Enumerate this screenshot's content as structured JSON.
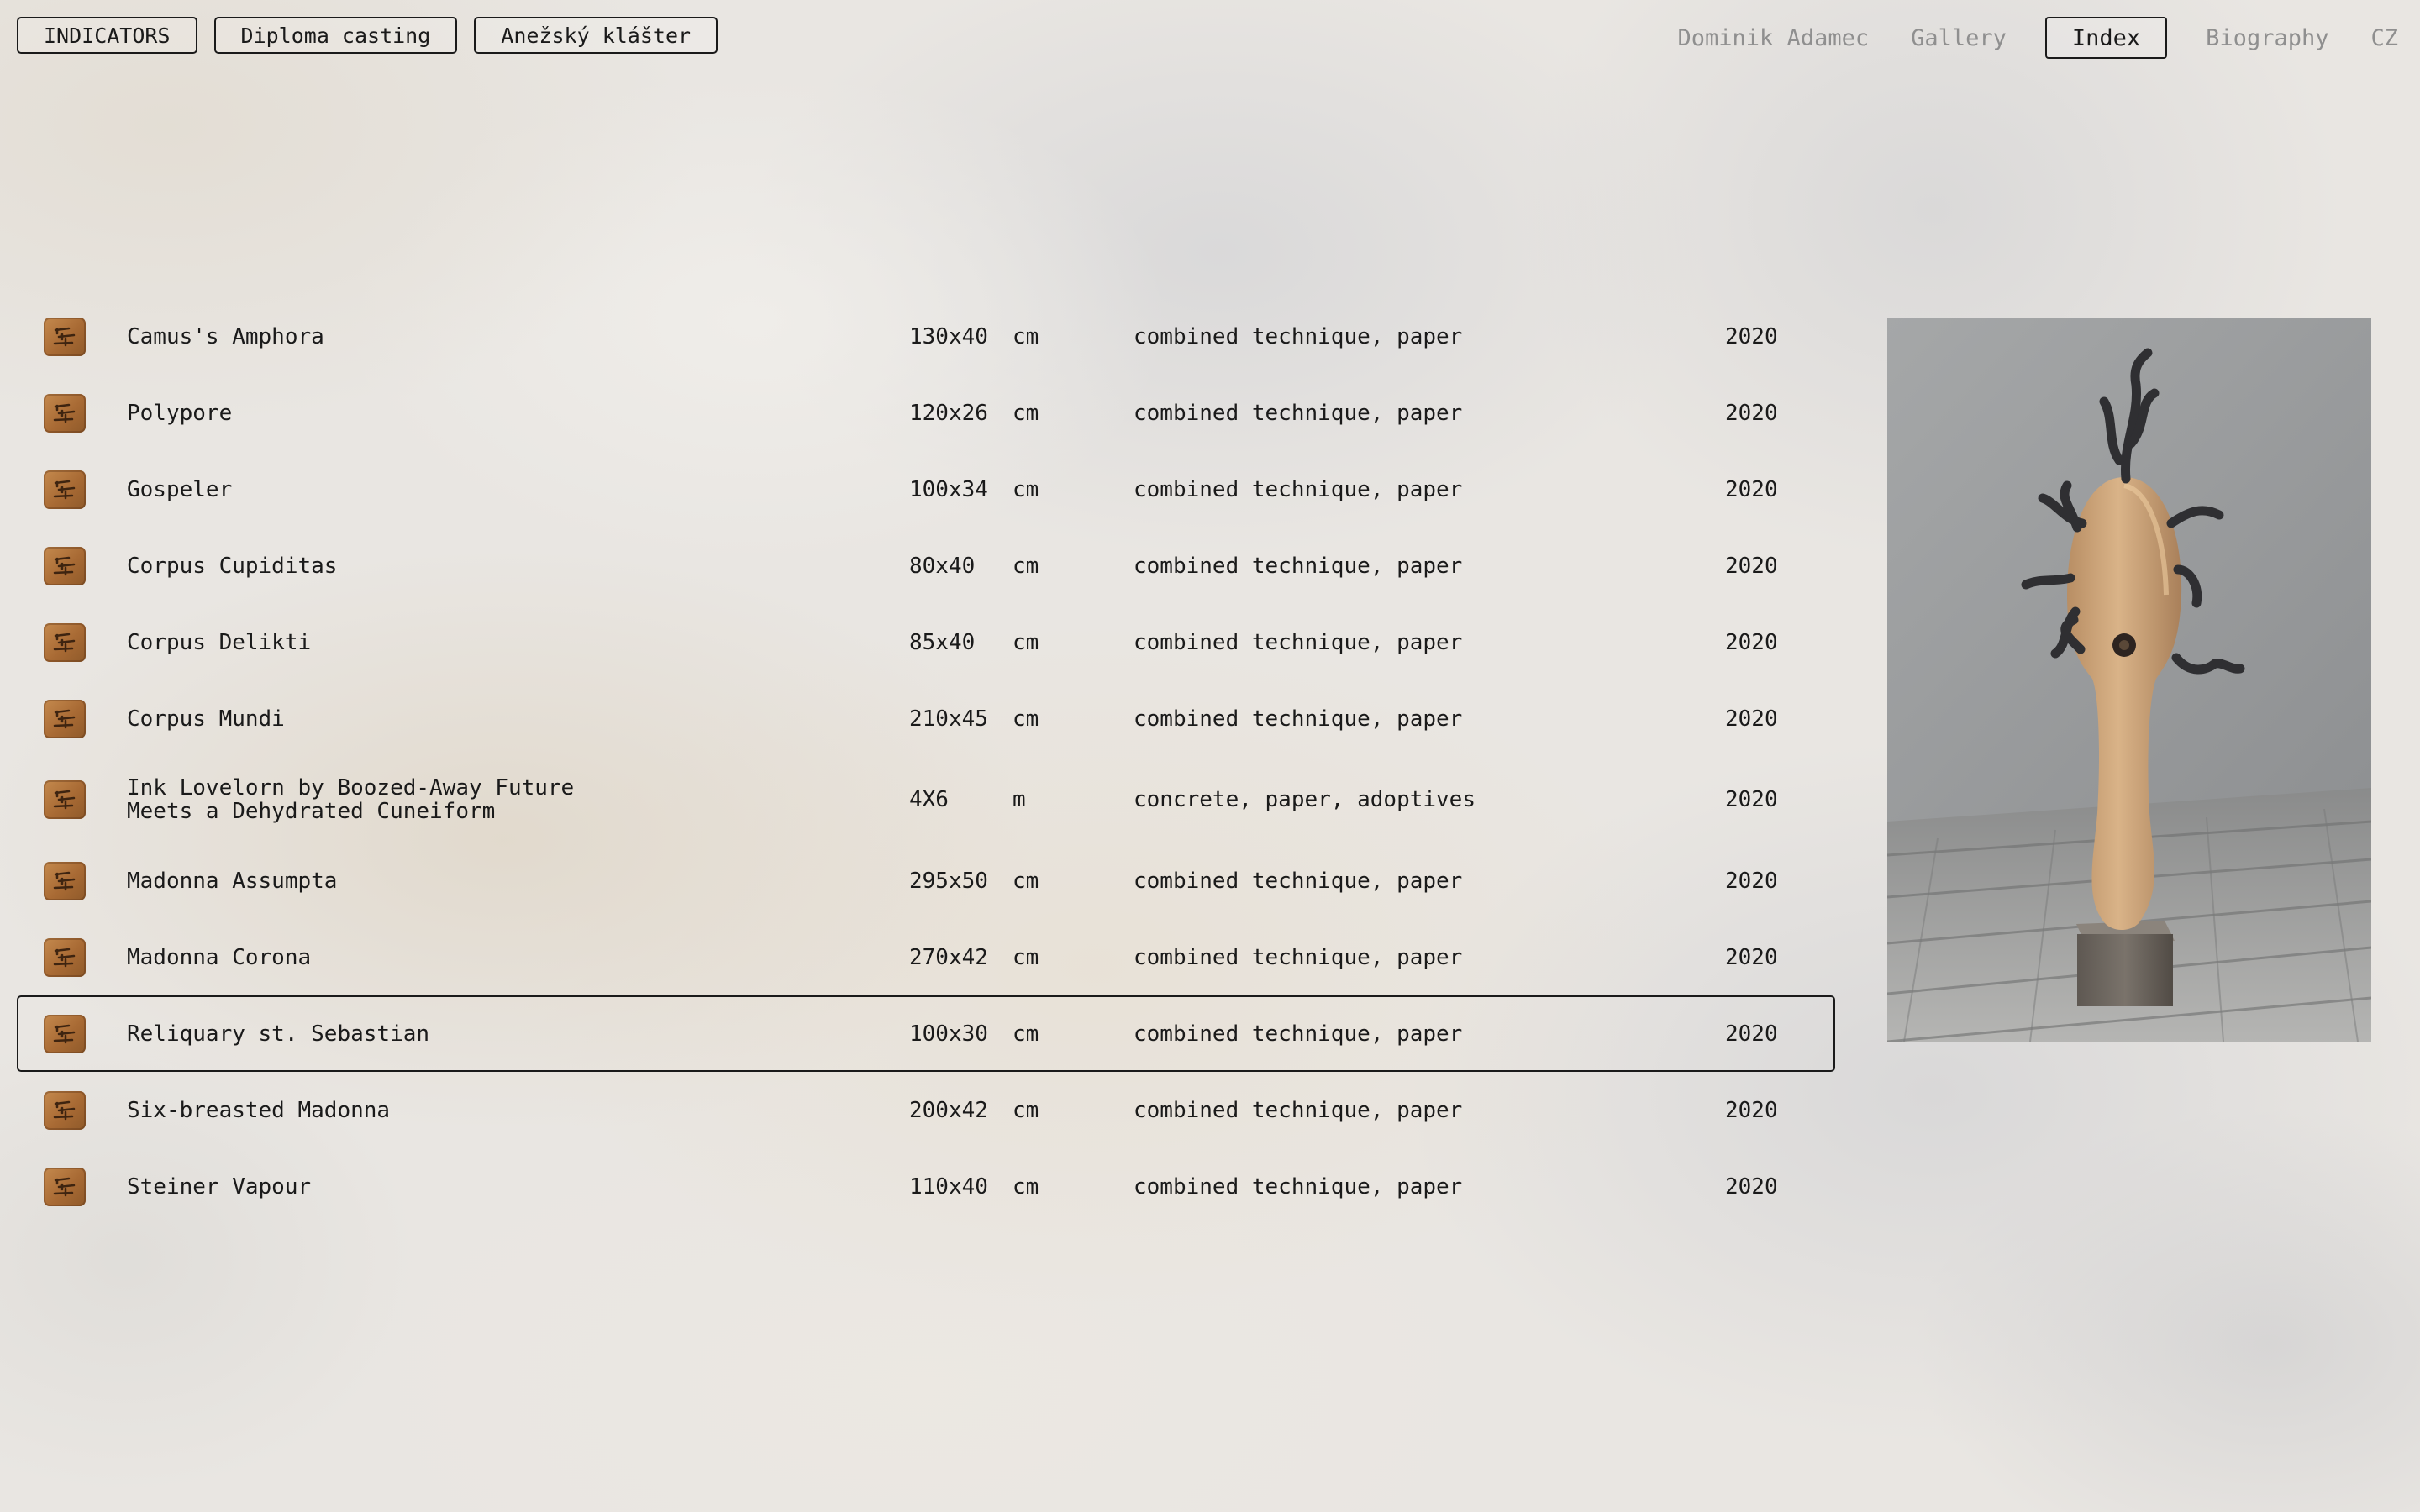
{
  "header": {
    "tags": [
      "INDICATORS",
      "Diploma casting",
      "Anežský klášter"
    ],
    "nav": {
      "artist": "Dominik Adamec",
      "gallery": "Gallery",
      "index": "Index",
      "biography": "Biography",
      "language": "CZ"
    },
    "active_nav": "Index"
  },
  "works": [
    {
      "title": "Camus's Amphora",
      "dimensions": "130x40",
      "unit": "cm",
      "technique": "combined technique, paper",
      "year": "2020"
    },
    {
      "title": "Polypore",
      "dimensions": "120x26",
      "unit": "cm",
      "technique": "combined technique, paper",
      "year": "2020"
    },
    {
      "title": "Gospeler",
      "dimensions": "100x34",
      "unit": "cm",
      "technique": "combined technique, paper",
      "year": "2020"
    },
    {
      "title": "Corpus Cupiditas",
      "dimensions": "80x40",
      "unit": "cm",
      "technique": "combined technique, paper",
      "year": "2020"
    },
    {
      "title": "Corpus Delikti",
      "dimensions": "85x40",
      "unit": "cm",
      "technique": "combined technique, paper",
      "year": "2020"
    },
    {
      "title": "Corpus Mundi",
      "dimensions": "210x45",
      "unit": "cm",
      "technique": "combined technique, paper",
      "year": "2020"
    },
    {
      "title": "Ink Lovelorn by Boozed-Away Future Meets a Dehydrated Cuneiform",
      "dimensions": "4X6",
      "unit": "m",
      "technique": "concrete, paper, adoptives",
      "year": "2020"
    },
    {
      "title": "Madonna Assumpta",
      "dimensions": "295x50",
      "unit": "cm",
      "technique": "combined technique, paper",
      "year": "2020"
    },
    {
      "title": "Madonna Corona",
      "dimensions": "270x42",
      "unit": "cm",
      "technique": "combined technique, paper",
      "year": "2020"
    },
    {
      "title": "Reliquary st. Sebastian",
      "dimensions": "100x30",
      "unit": "cm",
      "technique": "combined technique, paper",
      "year": "2020"
    },
    {
      "title": "Six-breasted Madonna",
      "dimensions": "200x42",
      "unit": "cm",
      "technique": "combined technique, paper",
      "year": "2020"
    },
    {
      "title": "Steiner Vapour",
      "dimensions": "110x40",
      "unit": "cm",
      "technique": "combined technique, paper",
      "year": "2020"
    }
  ],
  "selected_work": "Reliquary st. Sebastian",
  "colors": {
    "text": "#1a1a1a",
    "nav_inactive": "#8f8f8f",
    "thumb": "#b0733a"
  },
  "icons": {
    "thumb": "artwork-thumbnail-icon"
  }
}
